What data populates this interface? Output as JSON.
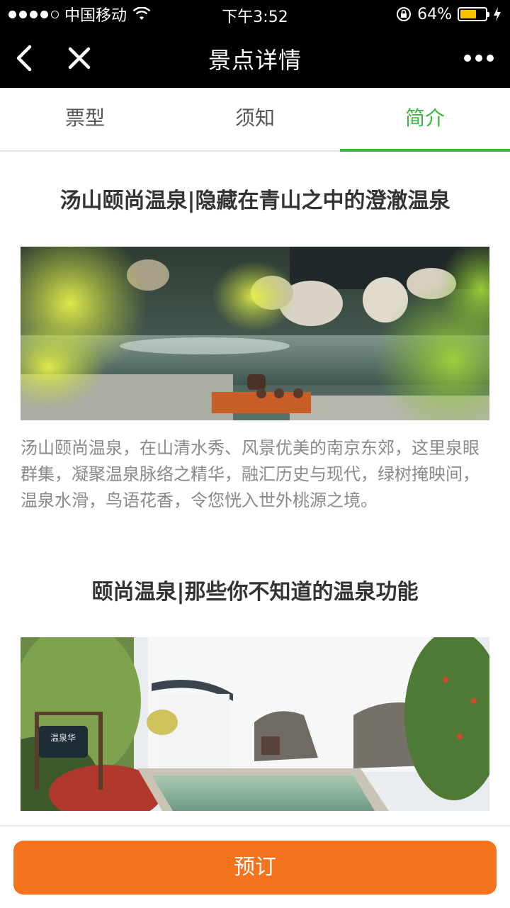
{
  "status_bar": {
    "carrier": "中国移动",
    "time": "下午3:52",
    "battery_percent": "64%",
    "battery_level": 0.64
  },
  "nav": {
    "title": "景点详情",
    "back_icon": "chevron-left-icon",
    "close_icon": "close-icon",
    "more_icon": "more-dots-icon"
  },
  "tabs": [
    {
      "label": "票型",
      "active": false
    },
    {
      "label": "须知",
      "active": false
    },
    {
      "label": "简介",
      "active": true
    }
  ],
  "content": {
    "section1_title": "汤山颐尚温泉|隐藏在青山之中的澄澈温泉",
    "section1_text": "汤山颐尚温泉，在山清水秀、风景优美的南京东郊，这里泉眼群集，凝聚温泉脉络之精华，融汇历史与现代，绿树掩映间，温泉水滑，鸟语花香，令您恍入世外桃源之境。",
    "section2_title": "颐尚温泉|那些你不知道的温泉功能",
    "plaque_text": "温泉华"
  },
  "footer": {
    "book_label": "预订"
  },
  "colors": {
    "accent_green": "#3ab63c",
    "book_orange": "#f5731c",
    "battery_yellow": "#f8c200"
  }
}
